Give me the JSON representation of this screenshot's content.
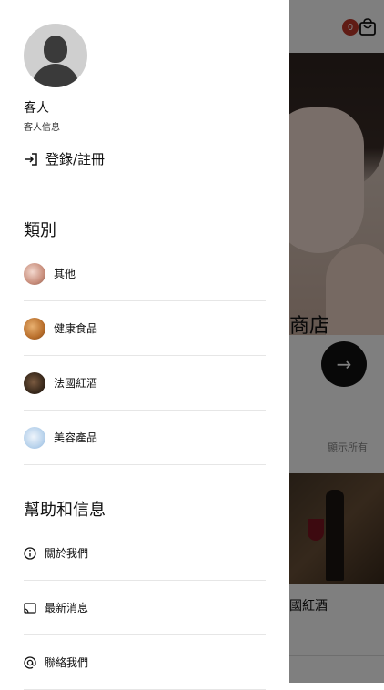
{
  "background": {
    "cart_badge": "0",
    "shop_title": "商店",
    "show_all": "顯示所有",
    "wine_caption": "國紅酒",
    "arrow_button": "→"
  },
  "drawer": {
    "user_name": "客人",
    "user_sub": "客人信息",
    "login_label": "登錄/註冊",
    "categories_title": "類別",
    "categories": [
      {
        "label": "其他"
      },
      {
        "label": "健康食品"
      },
      {
        "label": "法國紅酒"
      },
      {
        "label": "美容產品"
      }
    ],
    "help_title": "幫助和信息",
    "help_items": [
      {
        "label": "關於我們",
        "icon": "info-icon"
      },
      {
        "label": "最新消息",
        "icon": "cast-icon"
      },
      {
        "label": "聯絡我們",
        "icon": "at-icon"
      }
    ]
  },
  "colors": {
    "badge": "#c0392b",
    "overlay": "rgba(0,0,0,0.5)",
    "divider": "#e6e6e6"
  }
}
